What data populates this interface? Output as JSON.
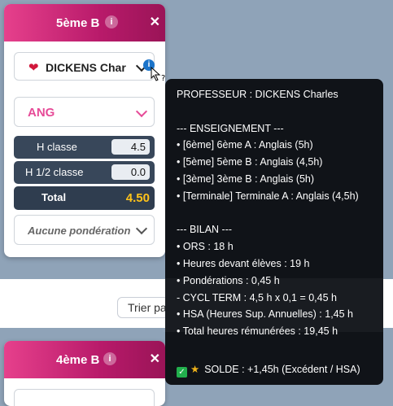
{
  "background_card": {
    "sort_button": "Trier pa"
  },
  "card1": {
    "title": "5ème B",
    "teacher": "DICKENS Char",
    "subject": "ANG",
    "rows": [
      {
        "label": "H classe",
        "value": "4.5"
      },
      {
        "label": "H 1/2 classe",
        "value": "0.0"
      }
    ],
    "total_label": "Total",
    "total_value": "4.50",
    "weighting": "Aucune pondération"
  },
  "card2": {
    "title": "4ème B"
  },
  "tooltip": {
    "lines": [
      "PROFESSEUR : DICKENS Charles",
      "",
      "--- ENSEIGNEMENT ---",
      "• [6ème] 6ème A : Anglais (5h)",
      "• [5ème] 5ème B : Anglais (4,5h)",
      "• [3ème] 3ème B : Anglais (5h)",
      "• [Terminale] Terminale A : Anglais (4,5h)",
      "",
      "--- BILAN ---",
      "• ORS : 18 h",
      "• Heures devant élèves : 19 h",
      "• Pondérations : 0,45 h",
      "- CYCL TERM : 4,5 h x 0,1 = 0,45 h",
      "• HSA (Heures Sup. Annuelles) : 1,45 h",
      "• Total heures rémunérées : 19,45 h",
      ""
    ],
    "solde": "SOLDE : +1,45h (Excédent / HSA)"
  },
  "colors": {
    "header": "#c81f78",
    "accent": "#e64a97",
    "total": "#ffc31a",
    "tooltip_bg": "#101318"
  },
  "icons": {
    "info": "info-icon",
    "close": "close-icon",
    "heart": "heart-icon",
    "check": "check-icon",
    "star": "star-icon"
  }
}
